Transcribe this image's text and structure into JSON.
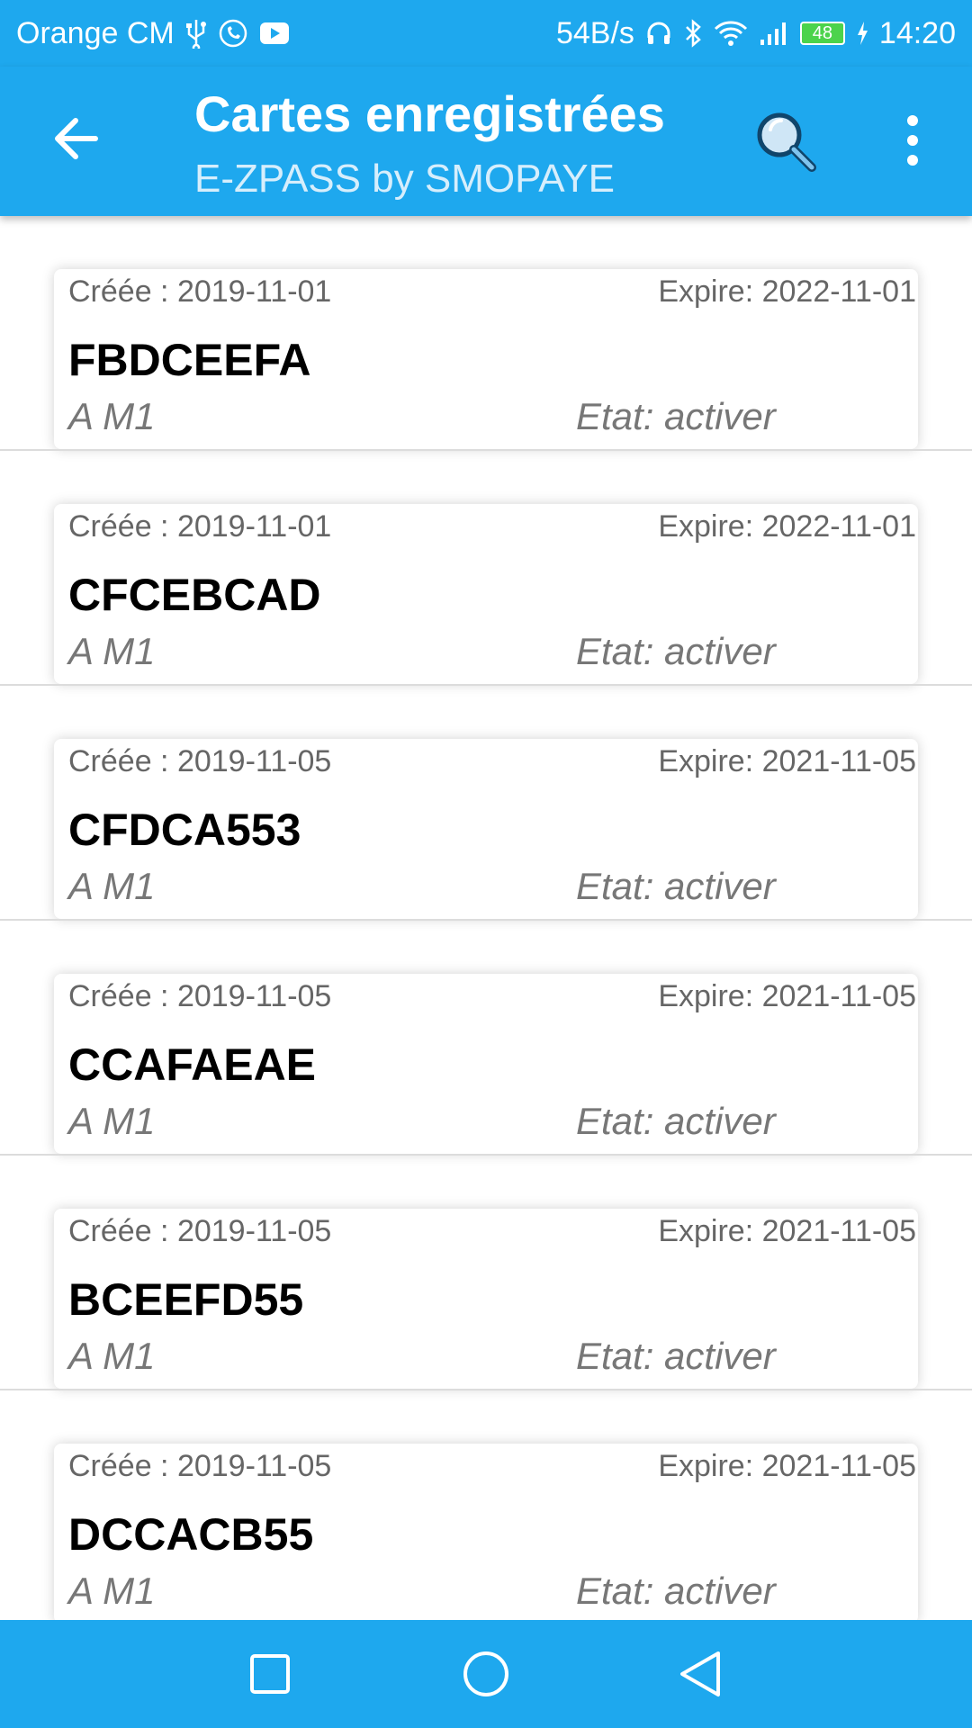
{
  "status_bar": {
    "carrier": "Orange CM",
    "net_speed": "54B/s",
    "battery": "48",
    "time": "14:20",
    "icons_left": [
      "usb-icon",
      "whatsapp-icon",
      "youtube-icon"
    ],
    "icons_right": [
      "headset-icon",
      "bluetooth-icon",
      "wifi-icon",
      "signal-icon",
      "battery-icon",
      "charging-icon"
    ]
  },
  "appbar": {
    "title": "Cartes enregistrées",
    "subtitle": "E-ZPASS by SMOPAYE",
    "icons": [
      "back-arrow-icon",
      "search-icon",
      "more-vert-icon"
    ]
  },
  "cards": [
    {
      "created": "Créée : 2019-11-01",
      "expires": "Expire: 2022-11-01",
      "code": "FBDCEEFA",
      "type": "A M1",
      "state": "Etat: activer"
    },
    {
      "created": "Créée : 2019-11-01",
      "expires": "Expire: 2022-11-01",
      "code": "CFCEBCAD",
      "type": "A M1",
      "state": "Etat: activer"
    },
    {
      "created": "Créée : 2019-11-05",
      "expires": "Expire: 2021-11-05",
      "code": "CFDCA553",
      "type": "A M1",
      "state": "Etat: activer"
    },
    {
      "created": "Créée : 2019-11-05",
      "expires": "Expire: 2021-11-05",
      "code": "CCAFAEAE",
      "type": "A M1",
      "state": "Etat: activer"
    },
    {
      "created": "Créée : 2019-11-05",
      "expires": "Expire: 2021-11-05",
      "code": "BCEEFD55",
      "type": "A M1",
      "state": "Etat: activer"
    },
    {
      "created": "Créée : 2019-11-05",
      "expires": "Expire: 2021-11-05",
      "code": "DCCACB55",
      "type": "A M1",
      "state": "Etat: activer"
    }
  ],
  "navbar": {
    "icons": [
      "recents-square-icon",
      "home-circle-icon",
      "back-triangle-icon"
    ]
  },
  "colors": {
    "primary": "#1ea8ee",
    "battery_green": "#4cd34c"
  }
}
